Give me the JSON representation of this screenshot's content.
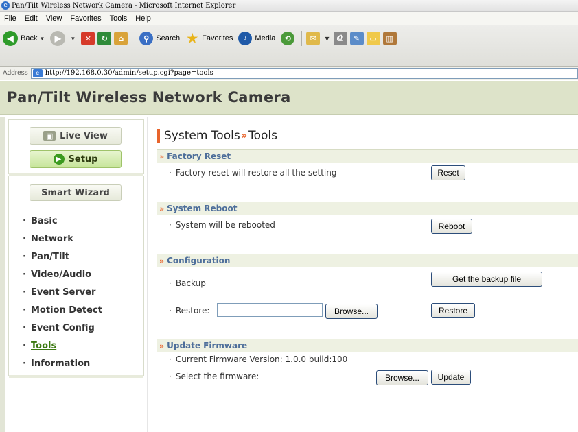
{
  "window": {
    "title": "Pan/Tilt Wireless Network Camera - Microsoft Internet Explorer"
  },
  "menu": [
    "File",
    "Edit",
    "View",
    "Favorites",
    "Tools",
    "Help"
  ],
  "toolbar": {
    "back": "Back",
    "search": "Search",
    "favorites": "Favorites",
    "media": "Media"
  },
  "address": {
    "label": "Address",
    "url": "http://192.168.0.30/admin/setup.cgi?page=tools"
  },
  "header": {
    "title": "Pan/Tilt Wireless Network Camera"
  },
  "sidebar": {
    "live_view": "Live View",
    "setup": "Setup",
    "smart_wizard": "Smart Wizard",
    "items": [
      {
        "label": "Basic",
        "active": false
      },
      {
        "label": "Network",
        "active": false
      },
      {
        "label": "Pan/Tilt",
        "active": false
      },
      {
        "label": "Video/Audio",
        "active": false
      },
      {
        "label": "Event Server",
        "active": false
      },
      {
        "label": "Motion Detect",
        "active": false
      },
      {
        "label": "Event Config",
        "active": false
      },
      {
        "label": "Tools",
        "active": true
      },
      {
        "label": "Information",
        "active": false
      }
    ]
  },
  "main": {
    "title_part1": "System Tools",
    "title_part2": "Tools",
    "factory_reset": {
      "heading": "Factory Reset",
      "text": "Factory reset will restore all the setting",
      "button": "Reset"
    },
    "system_reboot": {
      "heading": "System Reboot",
      "text": "System will be rebooted",
      "button": "Reboot"
    },
    "configuration": {
      "heading": "Configuration",
      "backup_label": "Backup",
      "backup_button": "Get the backup file",
      "restore_label": "Restore:",
      "restore_value": "",
      "browse_button": "Browse...",
      "restore_button": "Restore"
    },
    "update_firmware": {
      "heading": "Update Firmware",
      "version_text": "Current Firmware Version: 1.0.0 build:100",
      "select_label": "Select the firmware:",
      "select_value": "",
      "browse_button": "Browse...",
      "update_button": "Update"
    }
  }
}
